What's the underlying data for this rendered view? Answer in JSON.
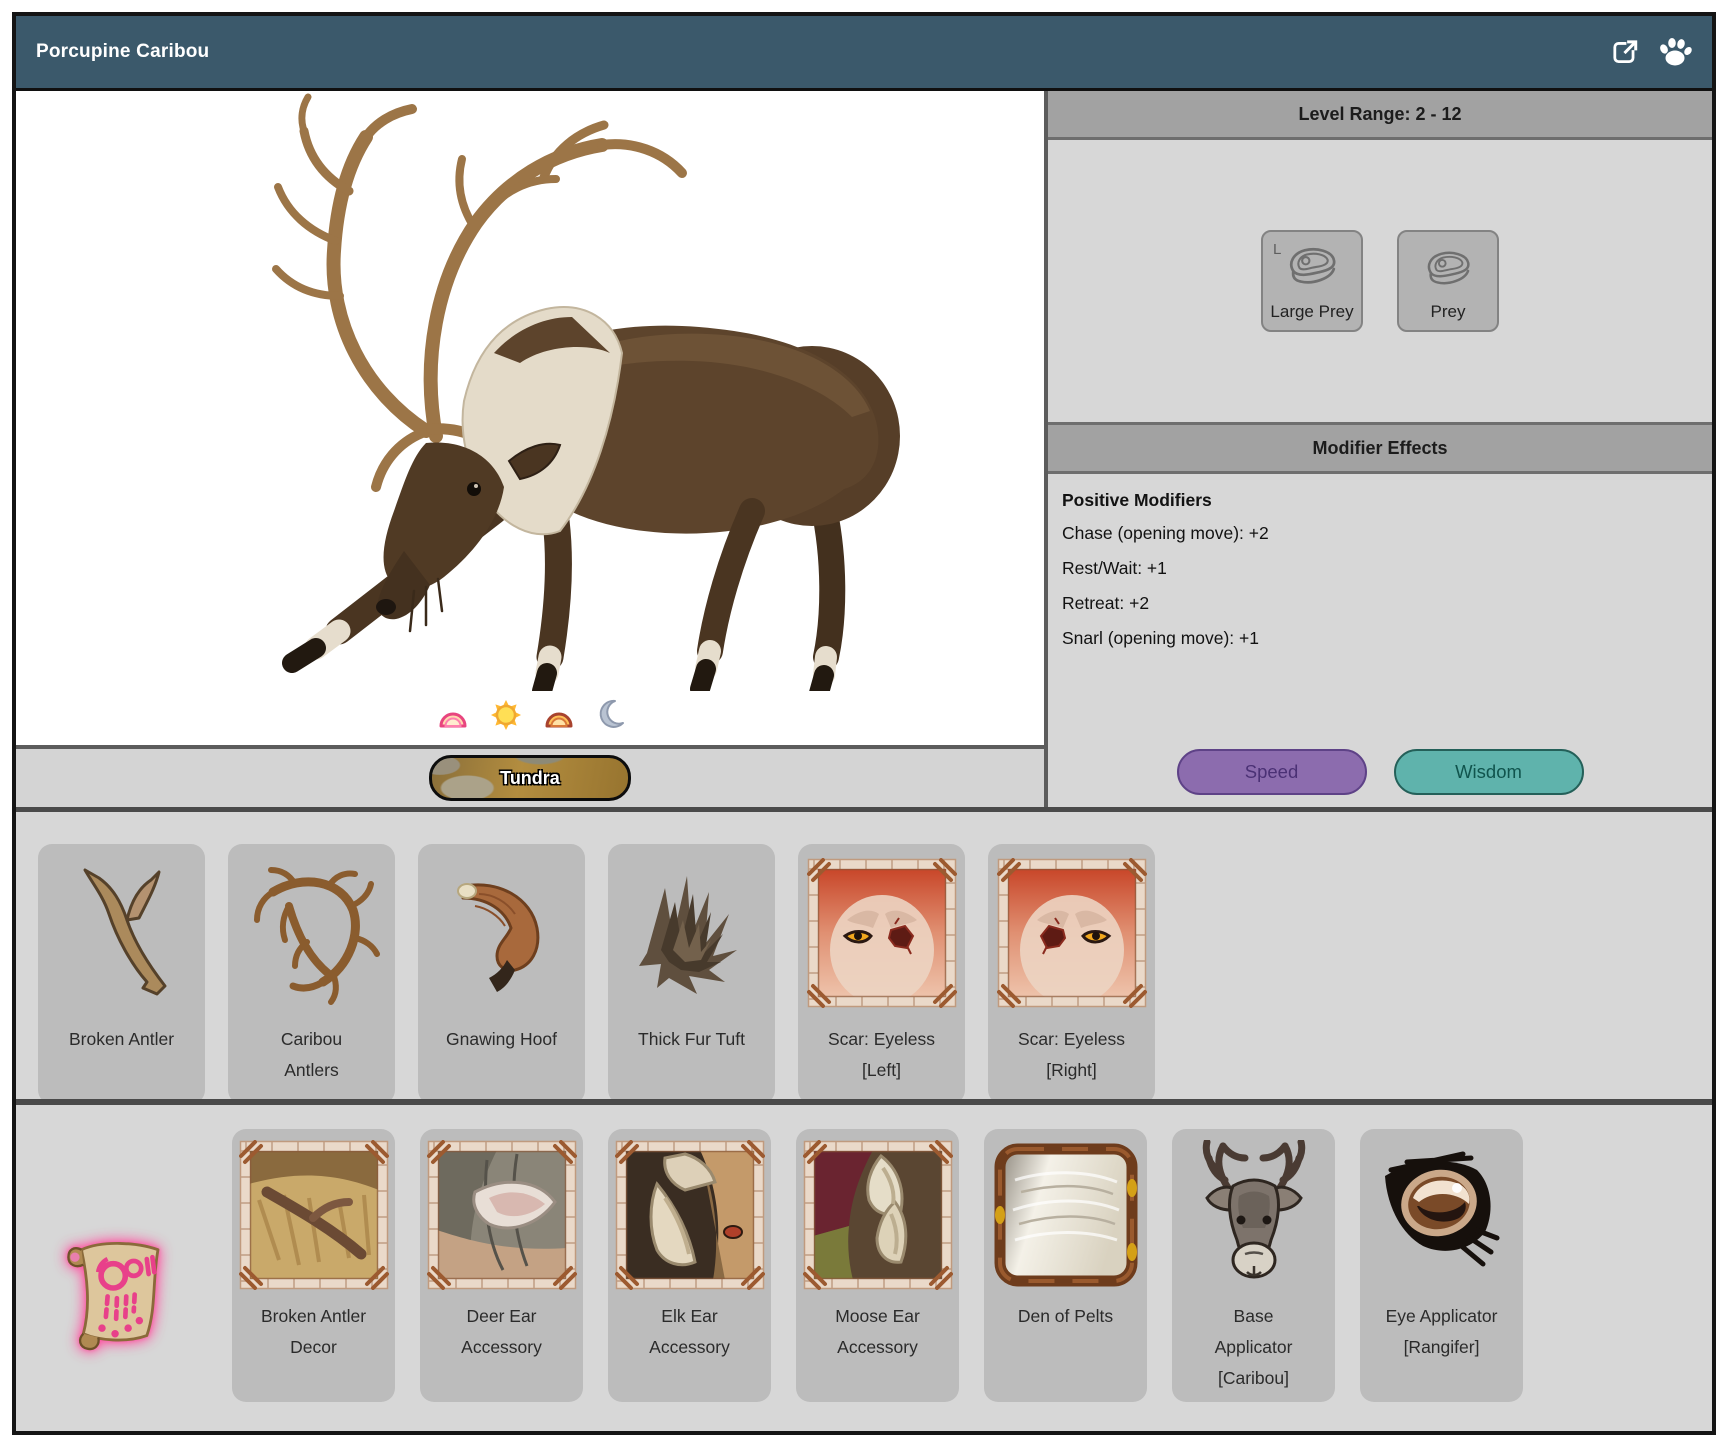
{
  "header": {
    "title": "Porcupine Caribou",
    "icons": [
      "external-link-icon",
      "paw-icon"
    ]
  },
  "left_panel": {
    "biome_label": "Tundra",
    "time_icons": [
      "sunrise",
      "day",
      "sunset",
      "night"
    ]
  },
  "right_panel": {
    "level_range_title": "Level Range: 2 - 12",
    "prey_buttons": [
      {
        "label": "Large Prey",
        "badge": "L",
        "icon": "steak-icon"
      },
      {
        "label": "Prey",
        "icon": "steak-icon"
      }
    ],
    "modifier_header": "Modifier Effects",
    "modifiers_title": "Positive Modifiers",
    "modifiers": [
      "Chase (opening move): +2",
      "Rest/Wait: +1",
      "Retreat: +2",
      "Snarl (opening move): +1"
    ],
    "stat_buttons": [
      {
        "label": "Speed",
        "color": "#8c6cae"
      },
      {
        "label": "Wisdom",
        "color": "#5fb3ac"
      }
    ]
  },
  "drops": {
    "items": [
      {
        "label": "Broken Antler"
      },
      {
        "label": "Caribou\nAntlers"
      },
      {
        "label": "Gnawing Hoof"
      },
      {
        "label": "Thick Fur Tuft"
      },
      {
        "label": "Scar: Eyeless\n[Left]"
      },
      {
        "label": "Scar: Eyeless\n[Right]"
      }
    ]
  },
  "decor": {
    "scroll_icon": "recipe-scroll-icon",
    "items": [
      {
        "label": "Broken Antler\nDecor"
      },
      {
        "label": "Deer Ear\nAccessory"
      },
      {
        "label": "Elk Ear\nAccessory"
      },
      {
        "label": "Moose Ear\nAccessory"
      },
      {
        "label": "Den of Pelts"
      },
      {
        "label": "Base\nApplicator\n[Caribou]"
      },
      {
        "label": "Eye Applicator\n[Rangifer]"
      }
    ]
  },
  "colors": {
    "header_teal": "#3b596b",
    "speed_purple": "#8c6cae",
    "wisdom_teal": "#5fb3ac",
    "rune_pink": "#e8408a"
  }
}
